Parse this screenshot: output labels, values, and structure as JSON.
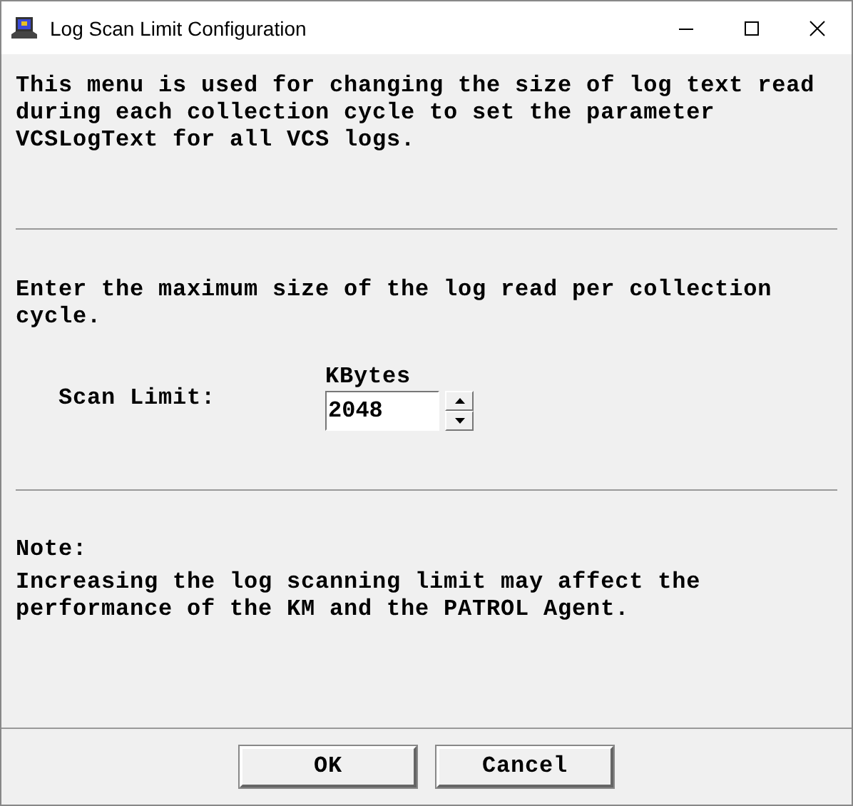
{
  "window": {
    "title": "Log Scan Limit Configuration"
  },
  "description": "This menu is used for changing the size of log text read during each collection cycle to set the parameter VCSLogText for all VCS logs.",
  "prompt": "Enter the maximum size of the log read per collection cycle.",
  "scan_limit": {
    "label": "Scan Limit:",
    "unit": "KBytes",
    "value": "2048"
  },
  "note": {
    "heading": "Note:",
    "text": "Increasing the log scanning limit may affect the performance of the KM and the PATROL Agent."
  },
  "buttons": [
    "OK",
    "Cancel"
  ]
}
